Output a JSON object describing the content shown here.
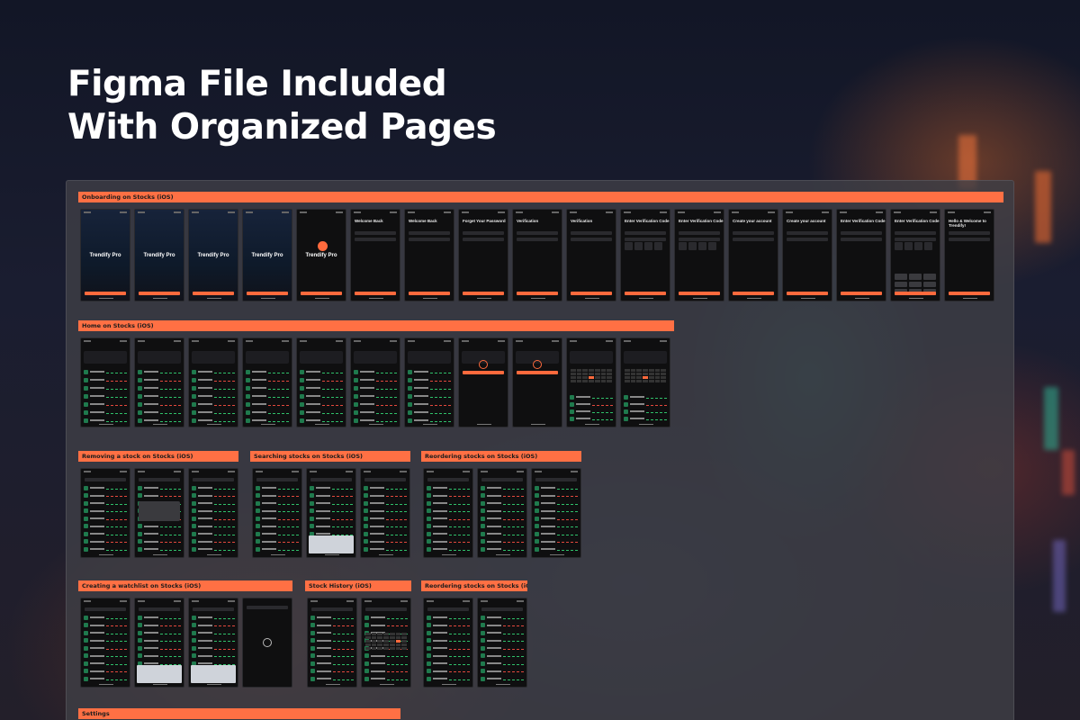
{
  "headline": {
    "line1": "Figma File Included",
    "line2": "With Organized Pages"
  },
  "sections": [
    {
      "title": "Onboarding on Stocks (iOS)"
    },
    {
      "title": "Home on Stocks (iOS)"
    },
    {
      "title": "Removing a stock on Stocks (iOS)"
    },
    {
      "title": "Searching stocks on Stocks (iOS)"
    },
    {
      "title": "Reordering stocks on Stocks (iOS)"
    },
    {
      "title": "Creating a watchlist on Stocks (iOS)"
    },
    {
      "title": "Stock History (iOS)"
    },
    {
      "title": "Reordering stocks on Stocks (iOS)"
    },
    {
      "title": "Settings"
    }
  ],
  "onboarding_screens": [
    {
      "title": "",
      "brand": "Trendify Pro"
    },
    {
      "title": "",
      "brand": "Trendify Pro"
    },
    {
      "title": "",
      "brand": "Trendify Pro"
    },
    {
      "title": "",
      "brand": "Trendify Pro"
    },
    {
      "title": "",
      "brand": "Trendify Pro"
    },
    {
      "title": "Welcome Back",
      "brand": ""
    },
    {
      "title": "Welcome Back",
      "brand": ""
    },
    {
      "title": "Forget Your Password",
      "brand": ""
    },
    {
      "title": "Verification",
      "brand": ""
    },
    {
      "title": "Verification",
      "brand": ""
    },
    {
      "title": "Enter Verification Code",
      "brand": ""
    },
    {
      "title": "Enter Verification Code",
      "brand": ""
    },
    {
      "title": "Create your account",
      "brand": ""
    },
    {
      "title": "Create your account",
      "brand": ""
    },
    {
      "title": "Enter Verification Code",
      "brand": ""
    },
    {
      "title": "Enter Verification Code",
      "brand": ""
    },
    {
      "title": "Hello & Welcome to Trendify!",
      "brand": ""
    }
  ],
  "colors": {
    "accent": "#ff6a3d",
    "panel": "#3e3e46",
    "screen": "#0f0f10",
    "up": "#2fc06a",
    "down": "#e2483d"
  }
}
